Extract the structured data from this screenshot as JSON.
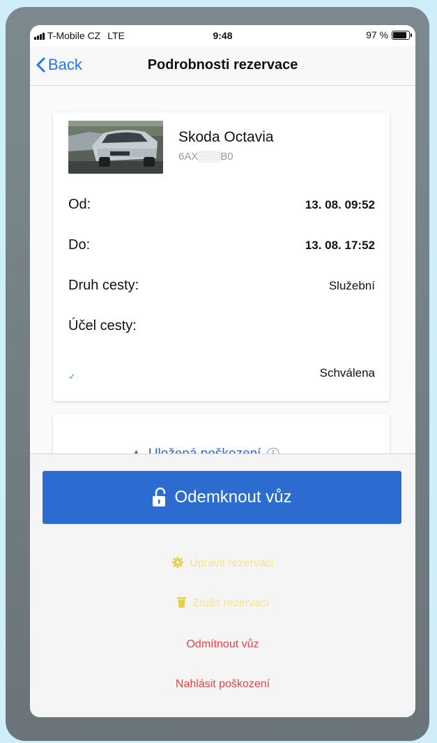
{
  "status_bar": {
    "carrier": "T-Mobile CZ",
    "network": "LTE",
    "time": "9:48",
    "battery": "97 %",
    "battery_level": 0.97
  },
  "navbar": {
    "back_label": "Back",
    "title": "Podrobnosti rezervace"
  },
  "reservation": {
    "car_name": "Skoda Octavia",
    "plate": "6AX░░░B0",
    "rows": [
      {
        "label": "Od:",
        "value": "13. 08. 09:52"
      },
      {
        "label": "Do:",
        "value": "13. 08. 17:52"
      },
      {
        "label": "Druh cesty:",
        "value": "Služební"
      },
      {
        "label": "Účel cesty:",
        "value": ""
      }
    ],
    "status_check": "✓",
    "status": "Schválena"
  },
  "damage_section": {
    "link_label": "Uložená poškození"
  },
  "actions": {
    "unlock_label": "Odemknout vůz",
    "edit_label": "Upravit rezervaci",
    "cancel_label": "Zrušit rezervaci",
    "reject_label": "Odmítnout vůz",
    "report_label": "Nahlásit poškození"
  },
  "colors": {
    "primary": "#2c6bd0",
    "link": "#1f74ff",
    "disabled": "#f2e68a",
    "danger": "#e8413f",
    "approved": "#3bb75a"
  }
}
